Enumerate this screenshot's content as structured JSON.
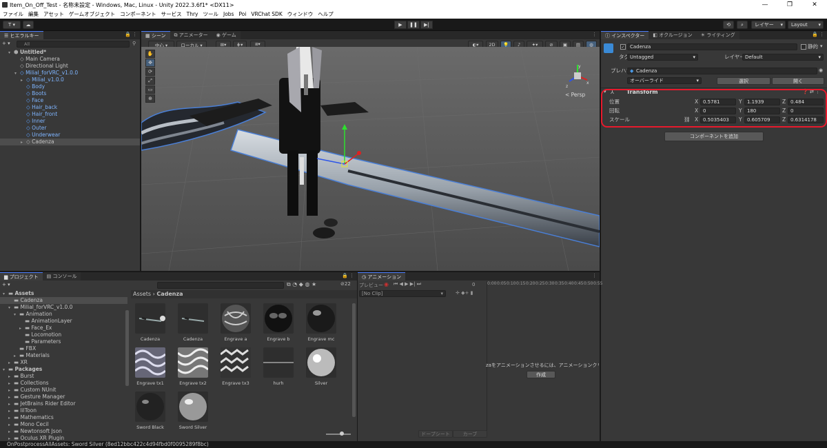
{
  "window": {
    "title": "Item_On_Off_Test - 名称未設定 - Windows, Mac, Linux - Unity 2022.3.6f1* <DX11>",
    "min": "—",
    "max": "❐",
    "close": "✕"
  },
  "menu": [
    "ファイル",
    "編集",
    "アセット",
    "ゲームオブジェクト",
    "コンポーネント",
    "サービス",
    "Thry",
    "ツール",
    "Jobs",
    "Poi",
    "VRChat SDK",
    "ウィンドウ",
    "ヘルプ"
  ],
  "toolbar": {
    "account": "T ▾",
    "cloud": "☁",
    "play": "▶",
    "pause": "❚❚",
    "step": "▶|",
    "history": "⟲",
    "search": "⌕",
    "layers": "レイヤー",
    "layout": "Layout"
  },
  "hierarchy": {
    "tab": "ヒエラルキー",
    "add": "+ ▾",
    "search_placeholder": "All",
    "items": [
      {
        "label": "Untitled*",
        "depth": 0,
        "bold": true,
        "tri": "▾"
      },
      {
        "label": "Main Camera",
        "depth": 1
      },
      {
        "label": "Directional Light",
        "depth": 1
      },
      {
        "label": "Milial_forVRC_v1.0.0",
        "depth": 1,
        "blue": true,
        "tri": "▾"
      },
      {
        "label": "Milial_v1.0.0",
        "depth": 2,
        "blue": true,
        "tri": "▸"
      },
      {
        "label": "Body",
        "depth": 2,
        "blue": true
      },
      {
        "label": "Boots",
        "depth": 2,
        "blue": true
      },
      {
        "label": "Face",
        "depth": 2,
        "blue": true
      },
      {
        "label": "Hair_back",
        "depth": 2,
        "blue": true
      },
      {
        "label": "Hair_front",
        "depth": 2,
        "blue": true
      },
      {
        "label": "Inner",
        "depth": 2,
        "blue": true
      },
      {
        "label": "Outer",
        "depth": 2,
        "blue": true
      },
      {
        "label": "Underwear",
        "depth": 2,
        "blue": true
      },
      {
        "label": "Cadenza",
        "depth": 2,
        "selected": true,
        "tri": "▸"
      }
    ]
  },
  "scene": {
    "tabs": [
      "シーン",
      "アニメーター",
      "ゲーム"
    ],
    "pivot": "中心 ▾",
    "space": "ローカル ▾",
    "mode2d": "2D",
    "persp": "< Persp",
    "gizmo": {
      "x": "x",
      "y": "y",
      "z": "z"
    }
  },
  "inspector": {
    "tabs": [
      "インスペクター",
      "オクルージョン",
      "ライティング"
    ],
    "object_name": "Cadenza",
    "static_label": "静的",
    "tag_label": "タグ",
    "tag_value": "Untagged",
    "layer_label": "レイヤー",
    "layer_value": "Default",
    "prefab_label": "プレハブ",
    "prefab_value": "Cadenza",
    "override": "オーバーライド",
    "select": "選択",
    "open": "開く",
    "component": "Transform",
    "rows": [
      {
        "label": "位置",
        "x": "0.5781",
        "y": "1.1939",
        "z": "0.484"
      },
      {
        "label": "回転",
        "x": "0",
        "y": "180",
        "z": "0"
      },
      {
        "label": "スケール",
        "x": "0.5035403",
        "y": "0.605709",
        "z": "0.6314178"
      }
    ],
    "axis": {
      "x": "X",
      "y": "Y",
      "z": "Z"
    },
    "add_component": "コンポーネントを追加",
    "highlight_color": "#e8192c"
  },
  "project": {
    "tabs": [
      "プロジェクト",
      "コンソール"
    ],
    "add": "+ ▾",
    "count": "22",
    "breadcrumb_root": "Assets",
    "breadcrumb_sep": "›",
    "breadcrumb_leaf": "Cadenza",
    "tree": [
      {
        "label": "Assets",
        "depth": 0,
        "bold": true,
        "tri": "▾"
      },
      {
        "label": "Cadenza",
        "depth": 1,
        "selected": true
      },
      {
        "label": "Milial_forVRC_v1.0.0",
        "depth": 1,
        "tri": "▾"
      },
      {
        "label": "Animation",
        "depth": 2,
        "tri": "▾"
      },
      {
        "label": "AnimationLayer",
        "depth": 3
      },
      {
        "label": "Face_Ex",
        "depth": 3,
        "tri": "▸"
      },
      {
        "label": "Locomotion",
        "depth": 3
      },
      {
        "label": "Parameters",
        "depth": 3
      },
      {
        "label": "FBX",
        "depth": 2
      },
      {
        "label": "Materials",
        "depth": 2,
        "tri": "▸"
      },
      {
        "label": "XR",
        "depth": 1,
        "tri": "▸"
      },
      {
        "label": "Packages",
        "depth": 0,
        "bold": true,
        "tri": "▾"
      },
      {
        "label": "Burst",
        "depth": 1,
        "tri": "▸"
      },
      {
        "label": "Collections",
        "depth": 1,
        "tri": "▸"
      },
      {
        "label": "Custom NUnit",
        "depth": 1,
        "tri": "▸"
      },
      {
        "label": "Gesture Manager",
        "depth": 1,
        "tri": "▸"
      },
      {
        "label": "JetBrains Rider Editor",
        "depth": 1,
        "tri": "▸"
      },
      {
        "label": "lilToon",
        "depth": 1,
        "tri": "▸"
      },
      {
        "label": "Mathematics",
        "depth": 1,
        "tri": "▸"
      },
      {
        "label": "Mono Cecil",
        "depth": 1,
        "tri": "▸"
      },
      {
        "label": "Newtonsoft Json",
        "depth": 1,
        "tri": "▸"
      },
      {
        "label": "Oculus XR Plugin",
        "depth": 1,
        "tri": "▸"
      }
    ],
    "assets": [
      {
        "name": "Cadenza",
        "kind": "sword"
      },
      {
        "name": "Cadenza",
        "kind": "sword2"
      },
      {
        "name": "Engrave a",
        "kind": "engrave"
      },
      {
        "name": "Engrave b",
        "kind": "darkball"
      },
      {
        "name": "Engrave mc",
        "kind": "darkball2"
      },
      {
        "name": "Engrave tx1",
        "kind": "tex"
      },
      {
        "name": "Engrave tx2",
        "kind": "tex2"
      },
      {
        "name": "Engrave tx3",
        "kind": "tex3"
      },
      {
        "name": "hurh",
        "kind": "line"
      },
      {
        "name": "Silver",
        "kind": "silver"
      },
      {
        "name": "Sword Black",
        "kind": "blackball"
      },
      {
        "name": "Sword Silver",
        "kind": "silverball"
      }
    ]
  },
  "animation": {
    "tab": "アニメーション",
    "preview": "プレビュー",
    "frame": "0",
    "clip": "[No Clip]",
    "ticks": [
      "0:00",
      "0:05",
      "0:10",
      "0:15",
      "0:20",
      "0:25",
      "0:30",
      "0:35",
      "0:40",
      "0:45",
      "0:50",
      "0:55"
    ],
    "message": "zaをアニメーションさせるには、アニメーションクリップを作成",
    "create": "作成",
    "dopesheet": "ドープシート",
    "curves": "カーブ"
  },
  "status": "OnPostprocessAllAssets: Sword Silver (8ed12bbc422c4d94fbd0f0095289f8bc)"
}
